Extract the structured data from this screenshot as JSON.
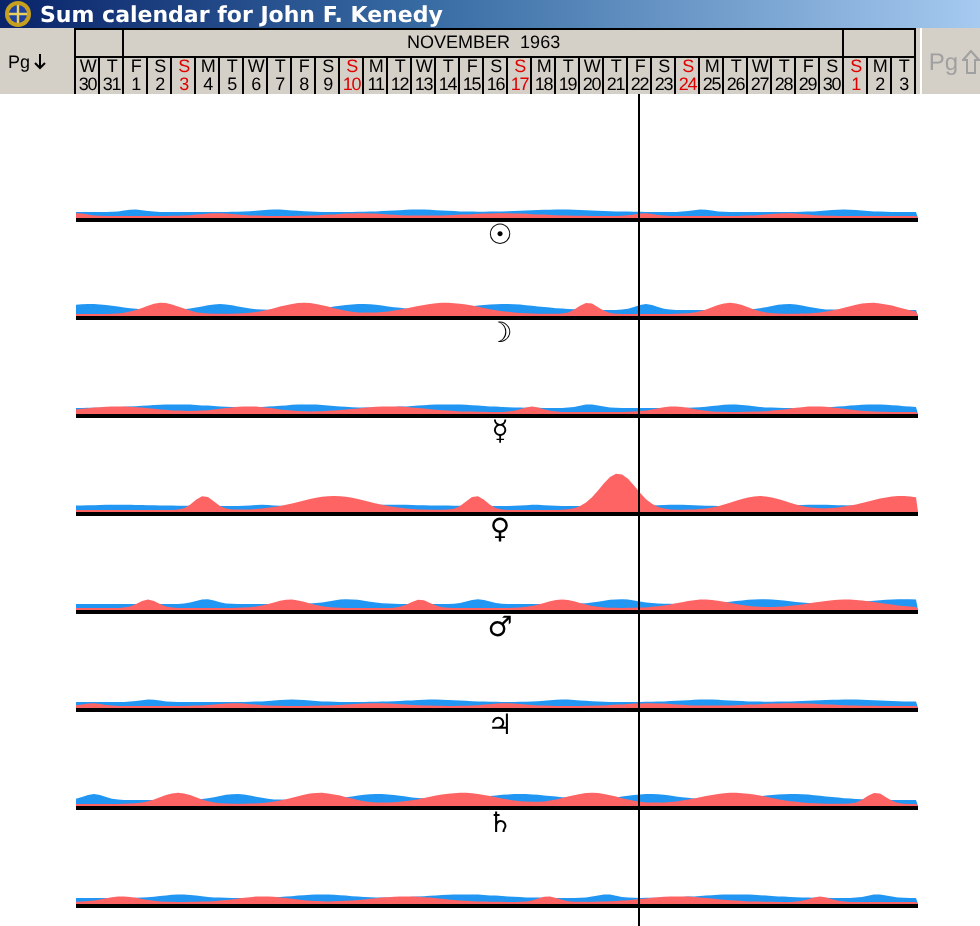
{
  "window": {
    "title": "Sum calendar for John F. Kenedy"
  },
  "page_down": {
    "label": "Pg",
    "disabled": false
  },
  "page_up": {
    "label": "Pg",
    "disabled": true
  },
  "months": [
    {
      "days": [
        {
          "weekday": "W",
          "date": "30",
          "sunday": false,
          "today": false
        },
        {
          "weekday": "T",
          "date": "31",
          "sunday": false,
          "today": false
        }
      ]
    },
    {
      "label": "NOVEMBER  1963",
      "days": [
        {
          "weekday": "F",
          "date": "1",
          "sunday": false,
          "today": false
        },
        {
          "weekday": "S",
          "date": "2",
          "sunday": false,
          "today": false
        },
        {
          "weekday": "S",
          "date": "3",
          "sunday": true,
          "today": false
        },
        {
          "weekday": "M",
          "date": "4",
          "sunday": false,
          "today": false
        },
        {
          "weekday": "T",
          "date": "5",
          "sunday": false,
          "today": false
        },
        {
          "weekday": "W",
          "date": "6",
          "sunday": false,
          "today": false
        },
        {
          "weekday": "T",
          "date": "7",
          "sunday": false,
          "today": false
        },
        {
          "weekday": "F",
          "date": "8",
          "sunday": false,
          "today": false
        },
        {
          "weekday": "S",
          "date": "9",
          "sunday": false,
          "today": false
        },
        {
          "weekday": "S",
          "date": "10",
          "sunday": true,
          "today": false
        },
        {
          "weekday": "M",
          "date": "11",
          "sunday": false,
          "today": false
        },
        {
          "weekday": "T",
          "date": "12",
          "sunday": false,
          "today": false
        },
        {
          "weekday": "W",
          "date": "13",
          "sunday": false,
          "today": false
        },
        {
          "weekday": "T",
          "date": "14",
          "sunday": false,
          "today": false
        },
        {
          "weekday": "F",
          "date": "15",
          "sunday": false,
          "today": false
        },
        {
          "weekday": "S",
          "date": "16",
          "sunday": false,
          "today": false
        },
        {
          "weekday": "S",
          "date": "17",
          "sunday": true,
          "today": false
        },
        {
          "weekday": "M",
          "date": "18",
          "sunday": false,
          "today": false
        },
        {
          "weekday": "T",
          "date": "19",
          "sunday": false,
          "today": false
        },
        {
          "weekday": "W",
          "date": "20",
          "sunday": false,
          "today": false
        },
        {
          "weekday": "T",
          "date": "21",
          "sunday": false,
          "today": false
        },
        {
          "weekday": "F",
          "date": "22",
          "sunday": false,
          "today": true
        },
        {
          "weekday": "S",
          "date": "23",
          "sunday": false,
          "today": false
        },
        {
          "weekday": "S",
          "date": "24",
          "sunday": true,
          "today": false
        },
        {
          "weekday": "M",
          "date": "25",
          "sunday": false,
          "today": false
        },
        {
          "weekday": "T",
          "date": "26",
          "sunday": false,
          "today": false
        },
        {
          "weekday": "W",
          "date": "27",
          "sunday": false,
          "today": false
        },
        {
          "weekday": "T",
          "date": "28",
          "sunday": false,
          "today": false
        },
        {
          "weekday": "F",
          "date": "29",
          "sunday": false,
          "today": false
        },
        {
          "weekday": "S",
          "date": "30",
          "sunday": false,
          "today": false
        }
      ]
    },
    {
      "days": [
        {
          "weekday": "S",
          "date": "1",
          "sunday": true,
          "today": false
        },
        {
          "weekday": "M",
          "date": "2",
          "sunday": false,
          "today": false
        },
        {
          "weekday": "T",
          "date": "3",
          "sunday": false,
          "today": false
        }
      ]
    }
  ],
  "bands": [
    {
      "kind": "band",
      "symbol": "☉"
    },
    {
      "kind": "band",
      "symbol": "☽"
    },
    {
      "kind": "band",
      "symbol": "☿"
    },
    {
      "kind": "band",
      "symbol": "♀"
    },
    {
      "kind": "band",
      "symbol": "♂"
    },
    {
      "kind": "band",
      "symbol": "♃"
    },
    {
      "kind": "band",
      "symbol": "♄"
    },
    {
      "kind": "band"
    }
  ]
}
